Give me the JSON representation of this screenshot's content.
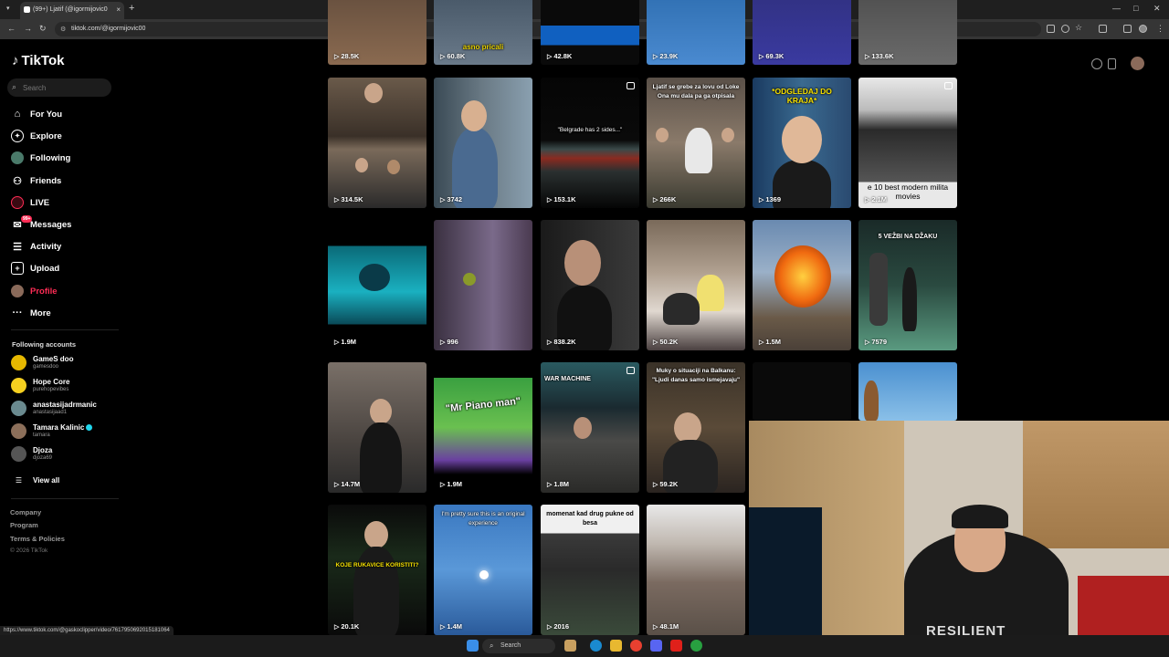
{
  "browser": {
    "tab_title": "(99+) Ljatif (@igormijovic0",
    "tab_close": "×",
    "new_tab": "+",
    "url": "tiktok.com/@igormijovic00",
    "status_url": "https://www.tiktok.com/@gaskoclipper/video/7617950692015181064"
  },
  "sidebar": {
    "logo": "TikTok",
    "search_placeholder": "Search",
    "menu": [
      {
        "label": "For You",
        "icon": "home-icon"
      },
      {
        "label": "Explore",
        "icon": "compass-icon"
      },
      {
        "label": "Following",
        "icon": "following-icon"
      },
      {
        "label": "Friends",
        "icon": "friends-icon"
      },
      {
        "label": "LIVE",
        "icon": "live-icon"
      },
      {
        "label": "Messages",
        "icon": "messages-icon",
        "badge": "99+"
      },
      {
        "label": "Activity",
        "icon": "activity-icon"
      },
      {
        "label": "Upload",
        "icon": "upload-icon"
      },
      {
        "label": "Profile",
        "icon": "profile-icon",
        "active": true
      },
      {
        "label": "More",
        "icon": "more-icon"
      }
    ],
    "following_title": "Following accounts",
    "accounts": [
      {
        "name": "GameS doo",
        "handle": "gamesdoo",
        "color": "#e6b800"
      },
      {
        "name": "Hope Core",
        "handle": "purehopevibes",
        "color": "#f5d020"
      },
      {
        "name": "anastasijadrmanic",
        "handle": "anastasijaad1",
        "color": "#6a8a8f"
      },
      {
        "name": "Tamara Kalinic",
        "handle": "tamara",
        "color": "#8c6f5a",
        "verified": true
      },
      {
        "name": "Djoza",
        "handle": "djoza69",
        "color": "#555555"
      }
    ],
    "view_all": "View all",
    "footer": [
      "Company",
      "Program",
      "Terms & Policies"
    ],
    "copyright": "© 2026 TikTok"
  },
  "grid": {
    "rows": [
      [
        {
          "views": "28.5K",
          "caption": ""
        },
        {
          "views": "60.8K",
          "caption": "asno pricali"
        },
        {
          "views": "42.8K",
          "caption": ""
        },
        {
          "views": "23.9K",
          "caption": ""
        },
        {
          "views": "69.3K",
          "caption": ""
        },
        {
          "views": "133.6K",
          "caption": ""
        }
      ],
      [
        {
          "views": "314.5K",
          "caption": ""
        },
        {
          "views": "3742",
          "caption": ""
        },
        {
          "views": "153.1K",
          "caption": "\"Belgrade has 2 sides...\""
        },
        {
          "views": "266K",
          "caption": "Ljatif se grebe za lovu od Loke Ona mu dala pa ga otpisala"
        },
        {
          "views": "1369",
          "caption": "*ODGLEDAJ DO KRAJA*"
        },
        {
          "views": "2.1M",
          "caption": "e 10 best modern milita movies"
        }
      ],
      [
        {
          "views": "1.9M",
          "caption": ""
        },
        {
          "views": "996",
          "caption": ""
        },
        {
          "views": "838.2K",
          "caption": ""
        },
        {
          "views": "50.2K",
          "caption": ""
        },
        {
          "views": "1.5M",
          "caption": ""
        },
        {
          "views": "7579",
          "caption": "5 VEŽBI NA DŽAKU"
        }
      ],
      [
        {
          "views": "14.7M",
          "caption": ""
        },
        {
          "views": "1.9M",
          "caption": "\"Mr Piano man\""
        },
        {
          "views": "1.8M",
          "caption": "WAR MACHINE"
        },
        {
          "views": "59.2K",
          "caption": "Muky o situaciji na Balkanu: \"Ljudi danas samo ismejavaju\""
        },
        {
          "views": "",
          "caption": ""
        },
        {
          "views": "",
          "caption": ""
        }
      ],
      [
        {
          "views": "20.1K",
          "caption": "KOJE RUKAVICE KORISTITI?"
        },
        {
          "views": "1.4M",
          "caption": "I'm pretty sure this is an original experience"
        },
        {
          "views": "2016",
          "caption": "momenat kad drug pukne od besa"
        },
        {
          "views": "48.1M",
          "caption": ""
        }
      ]
    ]
  },
  "taskbar": {
    "search": "Search"
  },
  "webcam": {
    "shirt_text": "RESILIENT"
  },
  "colors": {
    "accent": "#fe2c55",
    "verified": "#20d5ec"
  }
}
